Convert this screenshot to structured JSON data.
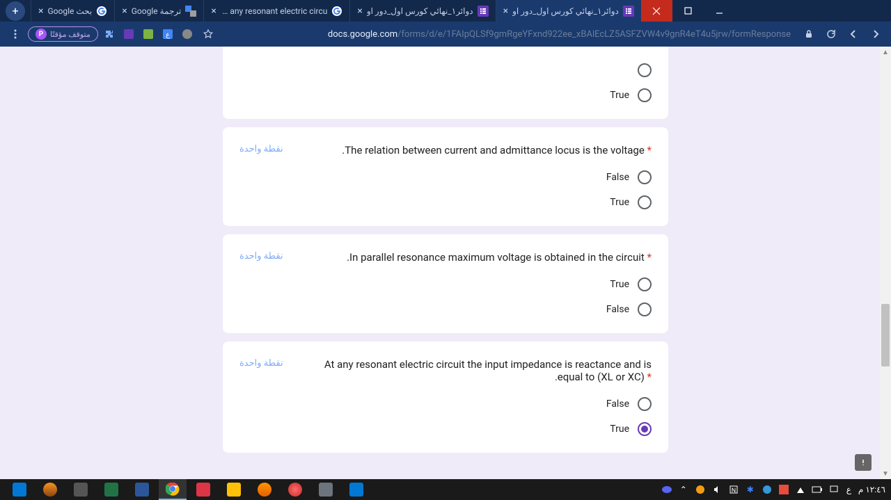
{
  "tabs": [
    {
      "title": "دوائر١_نهائي كورس اول_دور او",
      "favicon": "form-purple"
    },
    {
      "title": "دوائر١_نهائي كورس اول_دور او",
      "favicon": "form-purple"
    },
    {
      "title": "At any resonant electric circu",
      "favicon": "google-g"
    },
    {
      "title": "ترجمة Google",
      "favicon": "translate"
    },
    {
      "title": "بحث Google",
      "favicon": "google-g"
    }
  ],
  "url": {
    "domain": "docs.google.com",
    "path": "/forms/d/e/1FAIpQLSf9gmRgeYFxnd922ee_xBAlEcLZ5ASFZVW4v9gnR4eT4u5jrw/formResponse"
  },
  "badge_text": "متوقف مؤقتًا",
  "partial_question": {
    "options": [
      "True"
    ]
  },
  "questions": [
    {
      "text": ".The relation between current and admittance locus is the voltage",
      "points": "نقطة واحدة",
      "options": [
        "False",
        "True"
      ],
      "selected": null
    },
    {
      "text": ".In parallel resonance maximum voltage is obtained in the circuit",
      "points": "نقطة واحدة",
      "options": [
        "True",
        "False"
      ],
      "selected": null
    },
    {
      "text": "At any resonant electric circuit the input impedance is reactance and is .equal to (XL or XC)",
      "points": "نقطة واحدة",
      "options": [
        "False",
        "True"
      ],
      "selected": 1
    }
  ],
  "clock": "١٢:٤٦ م",
  "lang": "ع"
}
